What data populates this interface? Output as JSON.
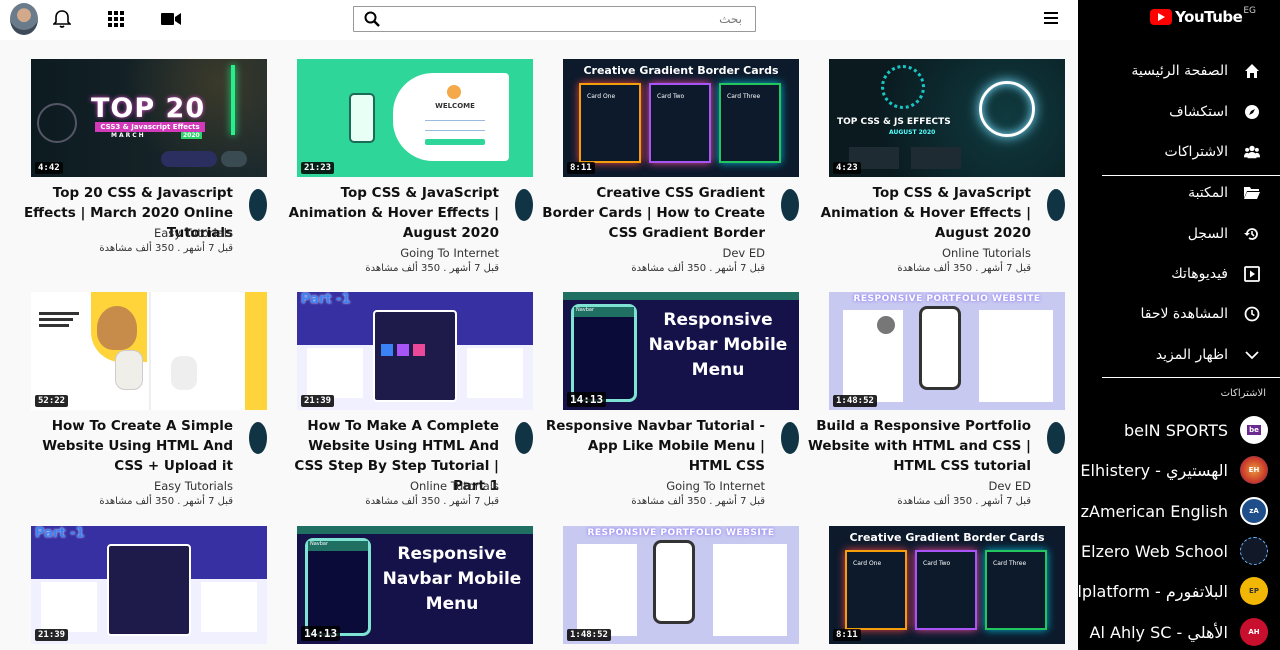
{
  "brand": {
    "name": "YouTube",
    "region": "EG"
  },
  "search": {
    "placeholder": "بحث"
  },
  "sidebar": {
    "items": [
      {
        "label": "الصفحة الرئيسية",
        "icon": "home-icon"
      },
      {
        "label": "استكشاف",
        "icon": "compass-icon"
      },
      {
        "label": "الاشتراكات",
        "icon": "subscriptions-icon"
      },
      {
        "label": "المكتبة",
        "icon": "folder-icon"
      },
      {
        "label": "السجل",
        "icon": "history-icon"
      },
      {
        "label": "فيديوهاتك",
        "icon": "play-square-icon"
      },
      {
        "label": "المشاهدة لاحقا",
        "icon": "clock-icon"
      },
      {
        "label": "اظهار المزيد",
        "icon": "chevron-down-icon"
      }
    ],
    "subs_header": "الاشتراكات",
    "subscriptions": [
      {
        "name": "beIN SPORTS",
        "avatar": "be",
        "color": "#6b2a8f"
      },
      {
        "name": "Elhistery - الهستيري",
        "avatar": "EH",
        "color": "#cc3a2a"
      },
      {
        "name": "zAmerican English",
        "avatar": "zA",
        "color": "#1f4f8a"
      },
      {
        "name": "Elzero Web School",
        "avatar": "",
        "color": "#111827"
      },
      {
        "name": "Elplatform - البلاتفورم",
        "avatar": "EP",
        "color": "#f2b705"
      },
      {
        "name": "Al Ahly SC - الأهلي",
        "avatar": "AH",
        "color": "#c8102e"
      }
    ]
  },
  "videos": [
    {
      "title": "Top 20 CSS & Javascript Effects | March 2020 Online Tutorials",
      "channel": "Easy Tutorials",
      "meta": "قبل 7 أشهر . 350 ألف مشاهدة",
      "duration": "4:42"
    },
    {
      "title": "Top CSS & JavaScript Animation & Hover Effects | August 2020",
      "channel": "Going To Internet",
      "meta": "قبل 7 أشهر . 350 ألف مشاهدة",
      "duration": "21:23"
    },
    {
      "title": "Creative CSS Gradient Border Cards | How to Create CSS Gradient Border",
      "channel": "Dev ED",
      "meta": "قبل 7 أشهر . 350 ألف مشاهدة",
      "duration": "8:11"
    },
    {
      "title": "Top CSS & JavaScript Animation & Hover Effects | August 2020",
      "channel": "Online Tutorials",
      "meta": "قبل 7 أشهر . 350 ألف مشاهدة",
      "duration": "4:23"
    },
    {
      "title": "How To Create A Simple Website Using HTML And CSS + Upload it",
      "channel": "Easy Tutorials",
      "meta": "قبل 7 أشهر . 350 ألف مشاهدة",
      "duration": "52:22"
    },
    {
      "title": "How To Make A Complete Website Using HTML And CSS Step By Step Tutorial | Part 1",
      "channel": "Online Tutorials",
      "meta": "قبل 7 أشهر . 350 ألف مشاهدة",
      "duration": "21:39"
    },
    {
      "title": "Responsive Navbar Tutorial - App Like Mobile Menu | HTML CSS",
      "channel": "Going To Internet",
      "meta": "قبل 7 أشهر . 350 ألف مشاهدة",
      "duration": "14:13"
    },
    {
      "title": "Build a Responsive Portfolio Website with HTML and CSS | HTML CSS tutorial",
      "channel": "Dev ED",
      "meta": "قبل 7 أشهر . 350 ألف مشاهدة",
      "duration": "1:48:52"
    },
    {
      "title": "",
      "channel": "",
      "meta": "",
      "duration": "21:39"
    },
    {
      "title": "",
      "channel": "",
      "meta": "",
      "duration": "14:13"
    },
    {
      "title": "",
      "channel": "",
      "meta": "",
      "duration": "1:48:52"
    },
    {
      "title": "",
      "channel": "",
      "meta": "",
      "duration": "8:11"
    }
  ],
  "thumb_text": {
    "top20": "TOP 20",
    "top20_sub": "CSS3 & Javascript Effects",
    "top20_month": "MARCH",
    "top20_year": "2020",
    "welcome": "WELCOME",
    "gradient_title": "Creative Gradient Border Cards",
    "card_one": "Card One",
    "card_two": "Card Two",
    "card_three": "Card Three",
    "topcss": "TOP CSS & JS EFFECTS",
    "topcss_month": "AUGUST 2020",
    "part1": "Part -1",
    "navbar_big": "Responsive Navbar Mobile Menu",
    "navbar_label": "Navbar",
    "portfolio": "RESPONSIVE PORTFOLIO WEBSITE"
  }
}
